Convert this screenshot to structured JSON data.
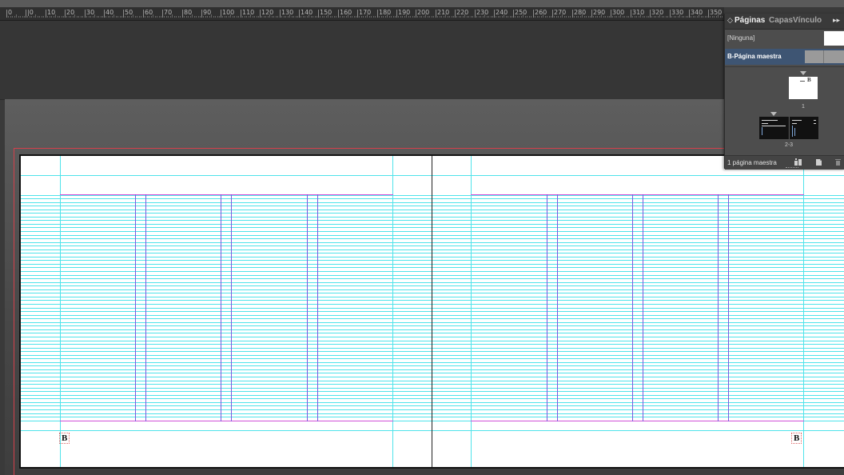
{
  "ruler": {
    "labels": [
      "0",
      "|0",
      "10",
      "20",
      "30",
      "40",
      "50",
      "60",
      "70",
      "80",
      "90",
      "100",
      "110",
      "120",
      "130",
      "140",
      "150",
      "160",
      "170",
      "180",
      "190",
      "200",
      "210",
      "220",
      "230",
      "240",
      "250",
      "260",
      "270",
      "280",
      "290",
      "300",
      "310",
      "320",
      "330",
      "340",
      "350"
    ]
  },
  "panel": {
    "tabs": [
      {
        "label": "Páginas",
        "active": true
      },
      {
        "label": "Capas",
        "active": false
      },
      {
        "label": "Vínculo",
        "active": false
      }
    ],
    "tab_arrow": "◇",
    "more_icon": "▸▸",
    "none_label": "[Ninguna]",
    "master_label": "B-Página maestra",
    "page1_marker": "B",
    "page1_number": "1",
    "spread_number": "2-3",
    "status_text": "1 página maestra"
  },
  "spread": {
    "left_marker": "B",
    "right_marker": "B"
  },
  "colors": {
    "guide_cyan": "#4fe3ea",
    "margin_magenta": "#d050d8",
    "column_violet": "#7a5ae0",
    "bleed_red": "#d4404b",
    "panel_highlight": "#3e5573"
  }
}
